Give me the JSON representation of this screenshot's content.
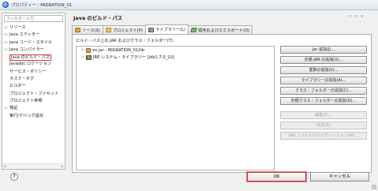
{
  "window": {
    "title": "プロパティー : MIGRATION_01"
  },
  "sidebar": {
    "filter_placeholder": "フィルター入力",
    "items": [
      {
        "label": "リソース",
        "expandable": true
      },
      {
        "label": "Java エディター",
        "expandable": true
      },
      {
        "label": "Java コード・スタイル",
        "expandable": true
      },
      {
        "label": "Java コンパイラー",
        "expandable": true
      },
      {
        "label": "Java のビルド・パス",
        "expandable": false,
        "selected": true
      },
      {
        "label": "Javadoc ロケーション",
        "expandable": false
      },
      {
        "label": "サービス・ポリシー",
        "expandable": false
      },
      {
        "label": "タスク・タグ",
        "expandable": false
      },
      {
        "label": "ビルダー",
        "expandable": false
      },
      {
        "label": "プロジェクト・ファセット",
        "expandable": false
      },
      {
        "label": "プロジェクト参照",
        "expandable": false
      },
      {
        "label": "検証",
        "expandable": true
      },
      {
        "label": "実行/デバッグ設定",
        "expandable": false
      }
    ],
    "scroll_left": "◂",
    "scroll_right": "▸"
  },
  "header": {
    "title": "Java のビルド・パス",
    "nav_back": "⇦",
    "nav_forward": "⇨",
    "nav_menu": "▾"
  },
  "tabs": [
    {
      "label": "ソース(S)",
      "icon": "source-folder-icon"
    },
    {
      "label": "プロジェクト(P)",
      "icon": "project-icon"
    },
    {
      "label": "ライブラリー(L)",
      "icon": "library-icon",
      "active": true
    },
    {
      "label": "順序およびエクスポート(O)",
      "icon": "order-export-icon"
    }
  ],
  "libraries": {
    "label": "ビルド・パス上の JAR およびクラス・フォルダー(T):",
    "items": [
      {
        "label": "ex.jar - MIGRATION_01/lib",
        "icon": "jar-icon"
      },
      {
        "label": "JRE システム・ライブラリー [jdk1.7.0_10]",
        "icon": "jre-library-icon"
      }
    ]
  },
  "buttons": {
    "add_jar": "Jar 追加(J)...",
    "add_external_jar": "外部 JAR の追加(X)...",
    "add_variable": "変数の追加(V)...",
    "add_library": "ライブラリーの追加(A)...",
    "add_class_folder": "クラス・フォルダーの追加(C)...",
    "add_external_class_folder": "外部クラス・フォルダーの追加(D)...",
    "edit": "編集(E)...",
    "remove": "除去(R)",
    "migrate_jar": "JAR ファイルのマイグレーション(M)..."
  },
  "footer": {
    "help": "?",
    "ok": "OK",
    "cancel": "キャンセル"
  }
}
